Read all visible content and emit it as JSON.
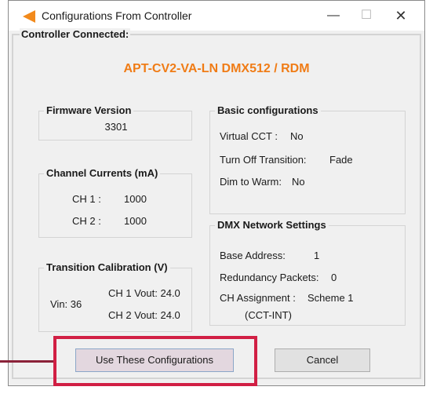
{
  "window": {
    "title": "Configurations From Controller",
    "minimize_glyph": "—",
    "maximize_glyph": "☐",
    "close_glyph": "✕",
    "icon": "arrow-left-icon",
    "accent": "#f07c16"
  },
  "status": {
    "label": "Controller Connected:",
    "device": "APT-CV2-VA-LN DMX512 / RDM"
  },
  "firmware": {
    "title": "Firmware Version",
    "value": "3301"
  },
  "channel_currents": {
    "title": "Channel Currents (mA)",
    "ch1_label": "CH 1 :",
    "ch1_value": "1000",
    "ch2_label": "CH 2 :",
    "ch2_value": "1000"
  },
  "transition_calibration": {
    "title": "Transition Calibration (V)",
    "vin": "Vin:  36",
    "ch1_vout": "CH 1 Vout: 24.0",
    "ch2_vout": "CH 2 Vout: 24.0"
  },
  "basic": {
    "title": "Basic configurations",
    "virtual_cct_label": "Virtual CCT :",
    "virtual_cct_value": "No",
    "turn_off_label": "Turn Off Transition:",
    "turn_off_value": "Fade",
    "dim_label": "Dim to Warm:",
    "dim_value": "No"
  },
  "dmx": {
    "title": "DMX  Network Settings",
    "base_label": "Base Address:",
    "base_value": "1",
    "redundancy_label": "Redundancy Packets:",
    "redundancy_value": "0",
    "assignment_label": "CH Assignment :",
    "assignment_value": "Scheme 1",
    "assignment_sub": "(CCT-INT)"
  },
  "buttons": {
    "use": "Use These Configurations",
    "cancel": "Cancel"
  },
  "annotation": {
    "highlight_color": "#d11f44"
  }
}
